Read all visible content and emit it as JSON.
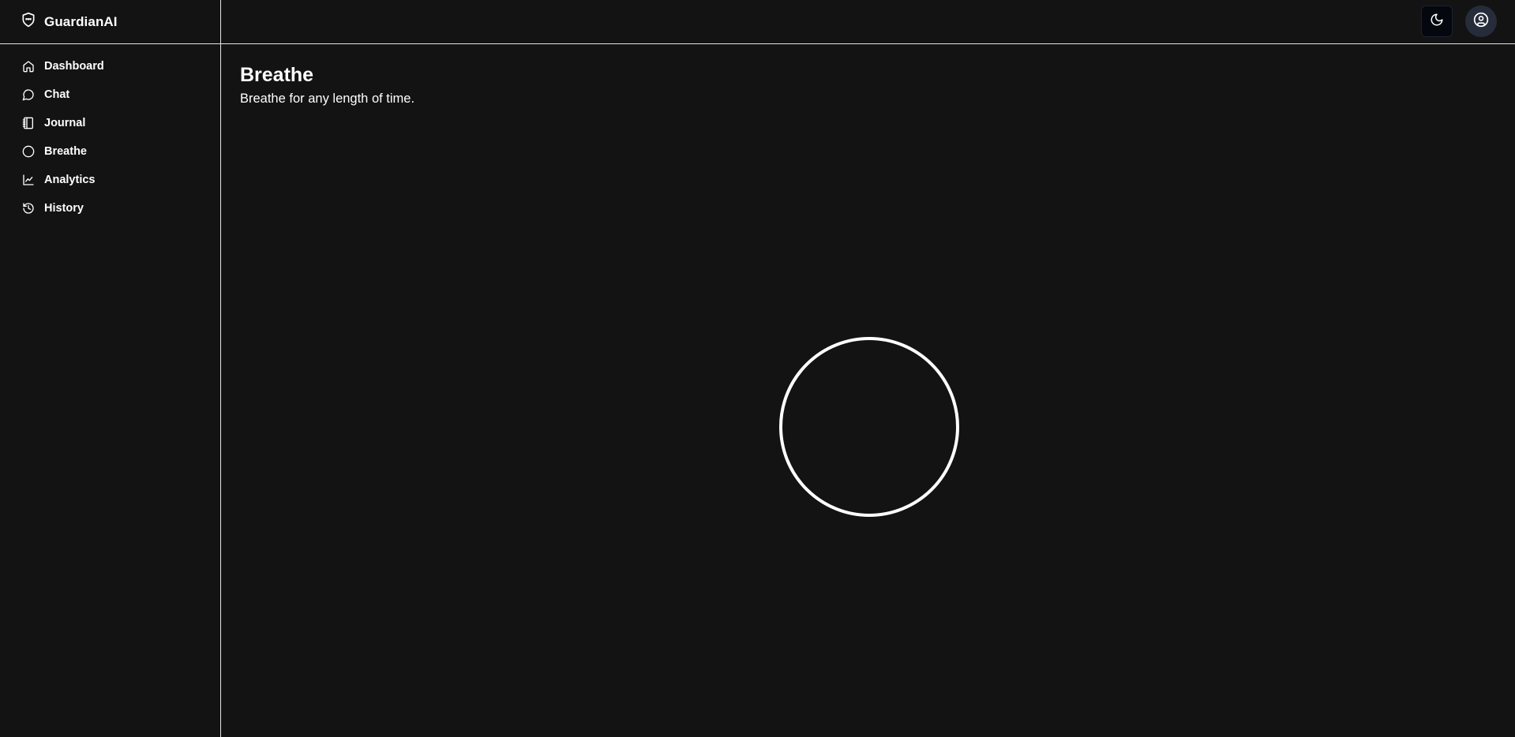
{
  "app": {
    "name": "GuardianAI"
  },
  "sidebar": {
    "items": [
      {
        "label": "Dashboard",
        "icon": "home-icon"
      },
      {
        "label": "Chat",
        "icon": "message-circle-icon"
      },
      {
        "label": "Journal",
        "icon": "notebook-icon"
      },
      {
        "label": "Breathe",
        "icon": "circle-icon"
      },
      {
        "label": "Analytics",
        "icon": "line-chart-icon"
      },
      {
        "label": "History",
        "icon": "history-icon"
      }
    ]
  },
  "header": {
    "theme_toggle_icon": "moon-icon",
    "account_icon": "user-circle-icon"
  },
  "main": {
    "title": "Breathe",
    "subtitle": "Breathe for any length of time."
  },
  "colors": {
    "background": "#131313",
    "border": "#e6e6e6",
    "text": "#ffffff",
    "theme_button_bg": "#05070f",
    "avatar_bg": "#262c3a"
  }
}
